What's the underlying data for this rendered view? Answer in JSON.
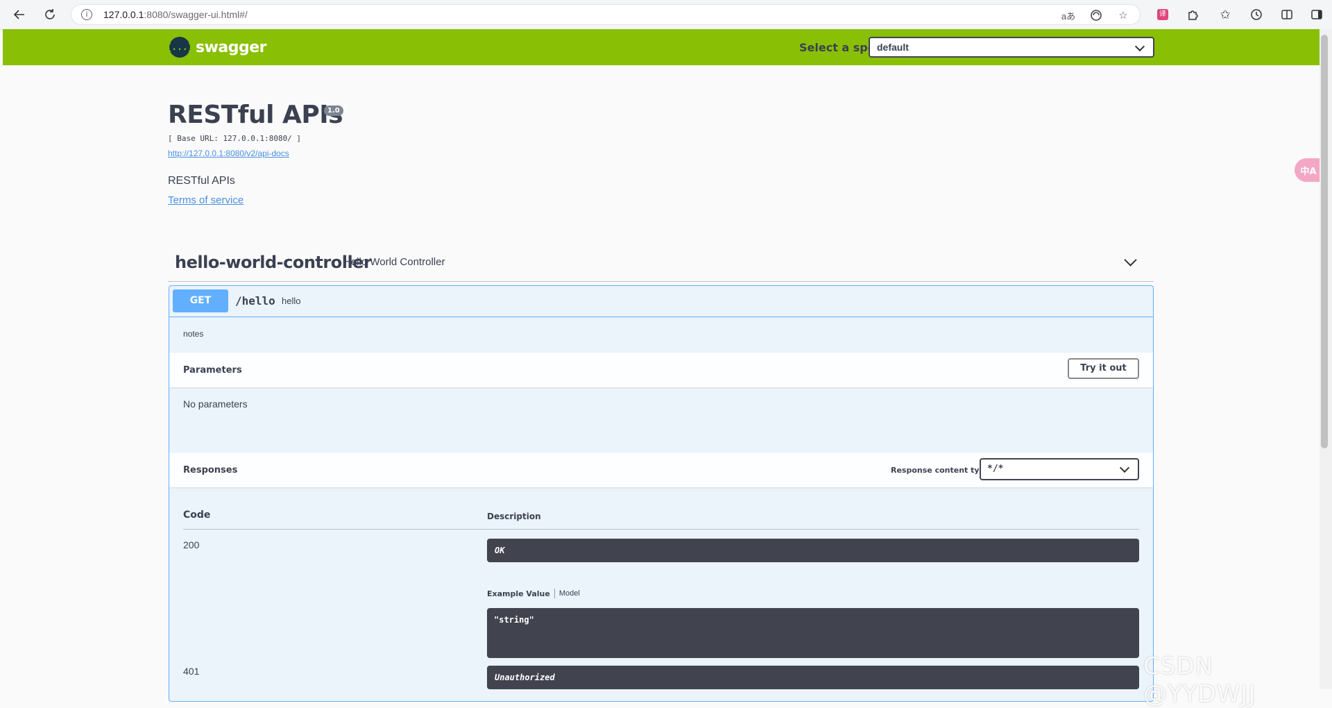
{
  "browser": {
    "url_host": "127.0.0.1",
    "url_rest": ":8080/swagger-ui.html#/",
    "icons": [
      "back-icon",
      "refresh-icon",
      "info-icon",
      "read-aloud-icon",
      "browser-essentials-icon",
      "favorite-star-icon",
      "extension-icon",
      "puzzle-icon",
      "favorites-icon",
      "history-icon",
      "split-screen-icon",
      "sidebar-icon"
    ]
  },
  "topbar": {
    "logo_text": "swagger",
    "logo_mark": "{...}",
    "spec_label": "Select a spec",
    "spec_value": "default",
    "background": "#89bf04"
  },
  "info": {
    "title": "RESTful APIs",
    "version": "1.0",
    "base_url": "[ Base URL: 127.0.0.1:8080/ ]",
    "api_docs_link": "http://127.0.0.1:8080/v2/api-docs",
    "description": "RESTful APIs",
    "terms_link": "Terms of service"
  },
  "tag": {
    "name": "hello-world-controller",
    "description": "Hello World Controller"
  },
  "operation": {
    "method": "GET",
    "path": "/hello",
    "summary": "hello",
    "notes": "notes",
    "method_color": "#61affe",
    "parameters": {
      "title": "Parameters",
      "try_button": "Try it out",
      "empty_text": "No parameters"
    },
    "responses": {
      "title": "Responses",
      "content_type_label": "Response content type",
      "content_type_value": "*/*",
      "col_code": "Code",
      "col_description": "Description",
      "items": [
        {
          "code": "200",
          "description": "OK"
        },
        {
          "code": "401",
          "description": "Unauthorized"
        }
      ],
      "example_tab": "Example Value",
      "model_tab": "Model",
      "example_value": "\"string\""
    }
  },
  "overlay": {
    "translate_button": "中A",
    "watermark": "CSDN @YYDWJJ"
  }
}
